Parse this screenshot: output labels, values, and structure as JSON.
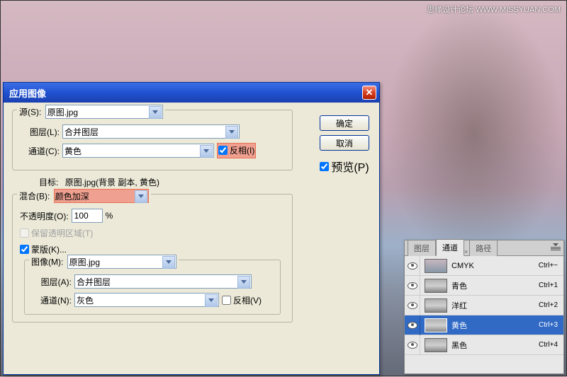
{
  "watermark": "思缘设计论坛   WWW.MISSYUAN.COM",
  "dialog": {
    "title": "应用图像",
    "source_legend": "源(S):",
    "source_value": "原图.jpg",
    "layer_label": "图层(L):",
    "layer_value": "合并图层",
    "channel_label": "通道(C):",
    "channel_value": "黄色",
    "invert_label": "反相(I)",
    "target_label": "目标:",
    "target_value": "原图.jpg(背景 副本, 黄色)",
    "blend_label": "混合(B):",
    "blend_value": "颜色加深",
    "opacity_label": "不透明度(O):",
    "opacity_value": "100",
    "opacity_pct": "%",
    "preserve_label": "保留透明区域(T)",
    "mask_label": "蒙版(K)...",
    "image_label": "图像(M):",
    "image_value": "原图.jpg",
    "mask_layer_label": "图层(A):",
    "mask_layer_value": "合并图层",
    "mask_channel_label": "通道(N):",
    "mask_channel_value": "灰色",
    "mask_invert_label": "反相(V)",
    "ok": "确定",
    "cancel": "取消",
    "preview": "预览(P)"
  },
  "panel": {
    "tab_layers": "图层",
    "tab_channels": "通道",
    "tab_paths": "路径",
    "channels": [
      {
        "name": "CMYK",
        "shortcut": "Ctrl+~"
      },
      {
        "name": "青色",
        "shortcut": "Ctrl+1"
      },
      {
        "name": "洋红",
        "shortcut": "Ctrl+2"
      },
      {
        "name": "黄色",
        "shortcut": "Ctrl+3"
      },
      {
        "name": "黑色",
        "shortcut": "Ctrl+4"
      }
    ]
  }
}
